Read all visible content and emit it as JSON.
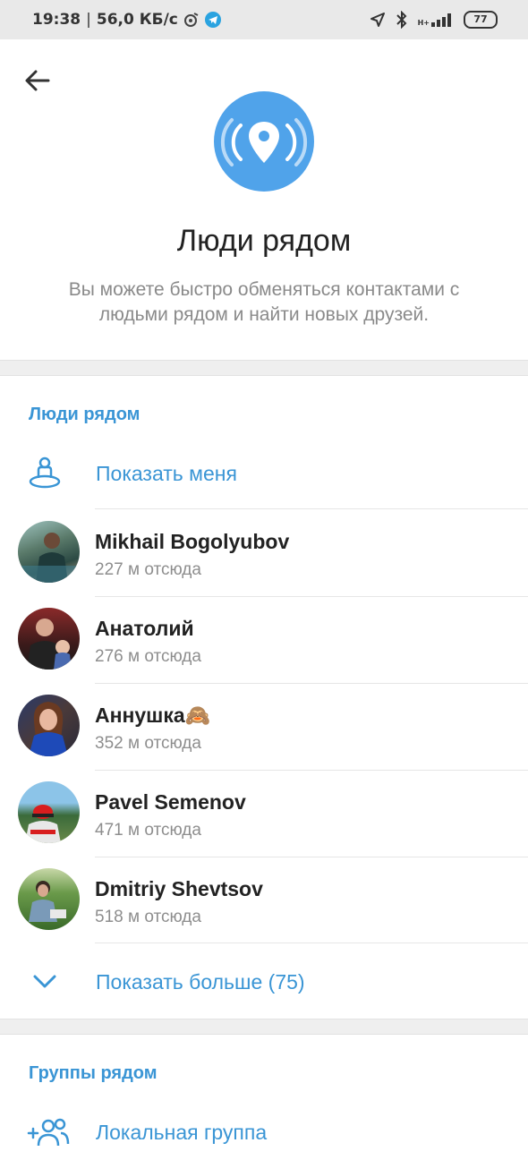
{
  "status_bar": {
    "time": "19:38",
    "speed": "56,0 КБ/с",
    "network": "H+",
    "battery": "77"
  },
  "header": {
    "title": "Люди рядом",
    "subtitle": "Вы можете быстро обменяться контактами с людьми рядом и найти новых друзей."
  },
  "people_section": {
    "title": "Люди рядом",
    "show_me_label": "Показать меня",
    "people": [
      {
        "name": "Mikhail Bogolyubov",
        "distance": "227 м отсюда"
      },
      {
        "name": "Анатолий",
        "distance": "276 м отсюда"
      },
      {
        "name": "Аннушка🙈",
        "distance": "352 м отсюда"
      },
      {
        "name": "Pavel Semenov",
        "distance": "471 м отсюда"
      },
      {
        "name": "Dmitriy Shevtsov",
        "distance": "518 м отсюда"
      }
    ],
    "show_more_label": "Показать больше (75)"
  },
  "groups_section": {
    "title": "Группы рядом",
    "local_group_label": "Локальная группа"
  },
  "colors": {
    "accent": "#3a95d5",
    "hero_circle": "#50a3ea",
    "secondary_text": "#8e8e8e"
  }
}
